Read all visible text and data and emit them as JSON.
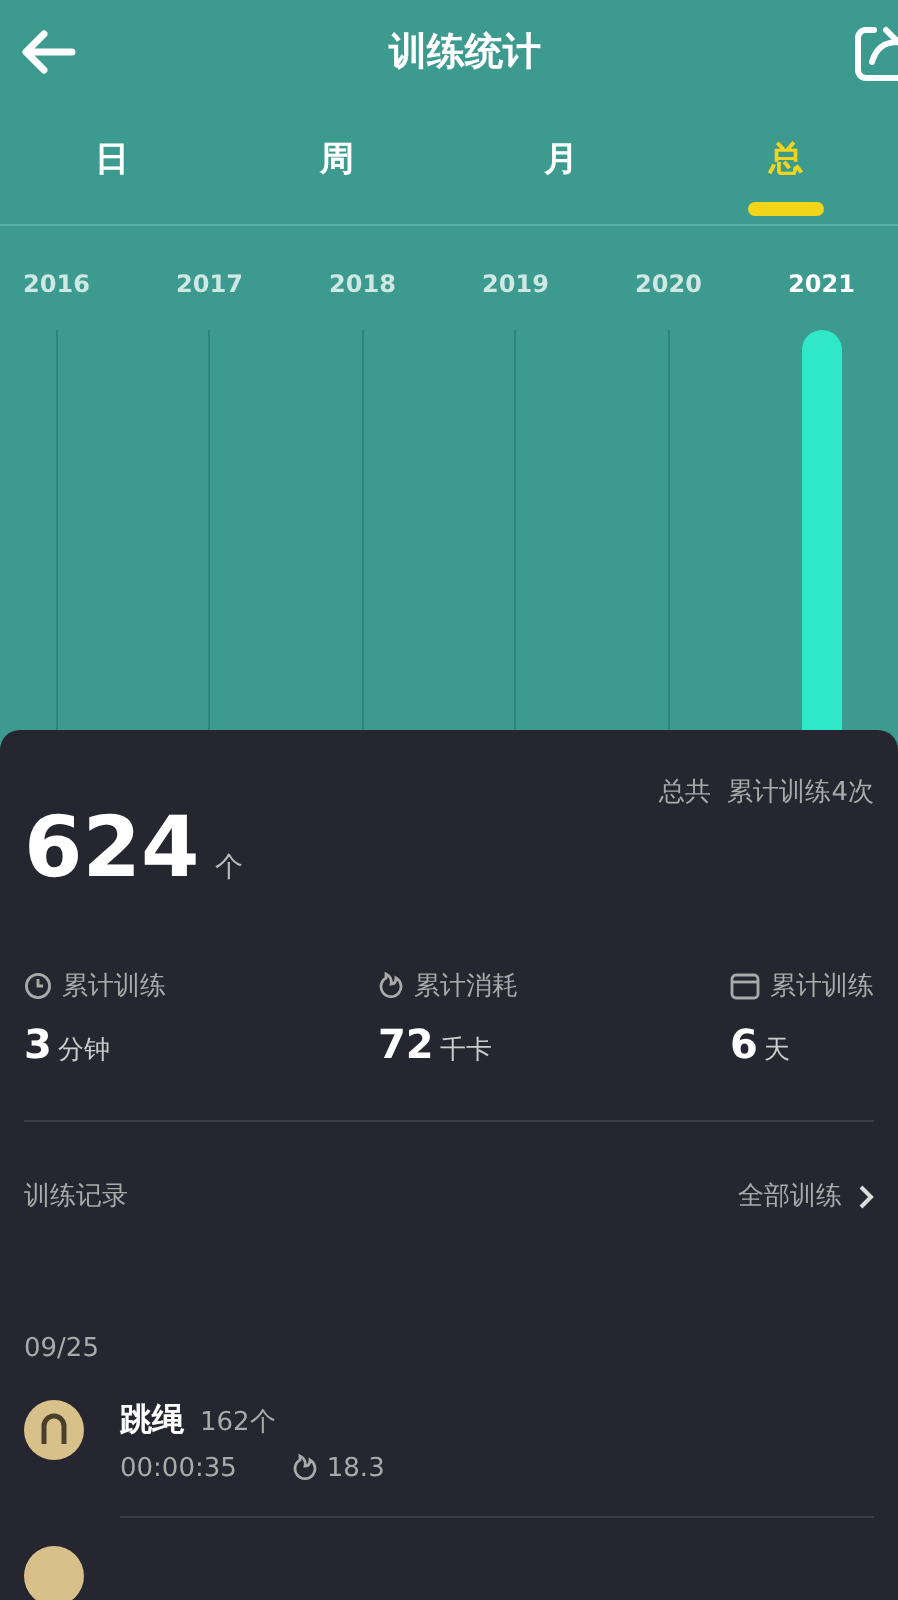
{
  "header": {
    "title": "训练统计"
  },
  "tabs": [
    {
      "label": "日",
      "selected": false
    },
    {
      "label": "周",
      "selected": false
    },
    {
      "label": "月",
      "selected": false
    },
    {
      "label": "总",
      "selected": true
    }
  ],
  "years": [
    {
      "label": "2016",
      "selected": false,
      "has_bar": false
    },
    {
      "label": "2017",
      "selected": false,
      "has_bar": false
    },
    {
      "label": "2018",
      "selected": false,
      "has_bar": false
    },
    {
      "label": "2019",
      "selected": false,
      "has_bar": false
    },
    {
      "label": "2020",
      "selected": false,
      "has_bar": false
    },
    {
      "label": "2021",
      "selected": true,
      "has_bar": true
    }
  ],
  "summary": {
    "value": "624",
    "unit": "个",
    "total_label": "总共",
    "total_text": "累计训练4次"
  },
  "stats": [
    {
      "kind": "clock",
      "label": "累计训练",
      "value": "3",
      "unit": "分钟"
    },
    {
      "kind": "flame",
      "label": "累计消耗",
      "value": "72",
      "unit": "千卡"
    },
    {
      "kind": "calendar",
      "label": "累计训练",
      "value": "6",
      "unit": "天"
    }
  ],
  "records_header": {
    "title": "训练记录",
    "link": "全部训练"
  },
  "records": [
    {
      "date": "09/25",
      "items": [
        {
          "name": "跳绳",
          "count": "162个",
          "duration": "00:00:35",
          "calories": "18.3"
        }
      ]
    }
  ]
}
